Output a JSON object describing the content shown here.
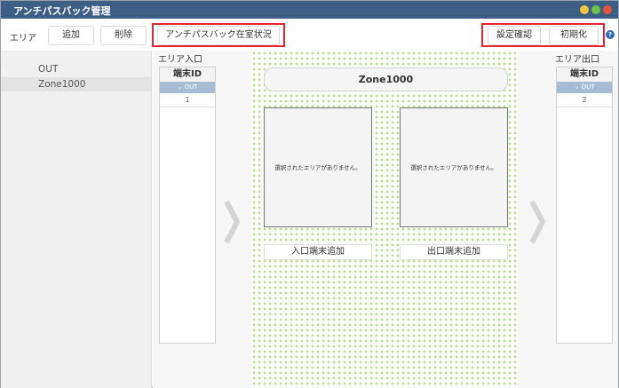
{
  "window": {
    "title": "アンチパスバック管理"
  },
  "toolbar": {
    "area_label": "エリア",
    "add_label": "追加",
    "delete_label": "削除",
    "status_label": "アンチパスバック在室状況",
    "settings_label": "設定確認",
    "init_label": "初期化",
    "help_glyph": "?"
  },
  "areas": [
    {
      "label": "OUT",
      "selected": false
    },
    {
      "label": "Zone1000",
      "selected": true
    }
  ],
  "entrance": {
    "label": "エリア入口",
    "column_header": "端末ID",
    "group": "⌄ OUT",
    "rows": [
      "1"
    ]
  },
  "exit": {
    "label": "エリア出口",
    "column_header": "端末ID",
    "group": "⌄ OUT",
    "rows": [
      "2"
    ]
  },
  "zone": {
    "title": "Zone1000",
    "entrance_box_text": "選択されたエリアがありません。",
    "exit_box_text": "選択されたエリアがありません。",
    "add_entrance_label": "入口端末追加",
    "add_exit_label": "出口端末追加"
  },
  "colors": {
    "titlebar": "#3d5f86",
    "highlight": "#e8232f",
    "group_header": "#a7bcd4",
    "dot": "#b7d98b"
  }
}
